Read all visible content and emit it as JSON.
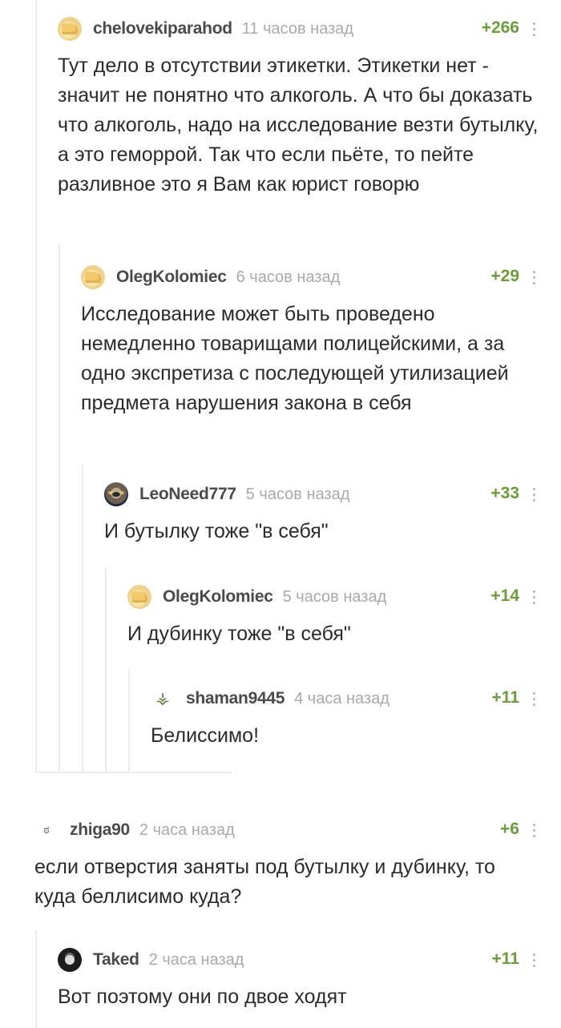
{
  "comments": [
    {
      "user": "chelovekiparahod",
      "time": "11 часов назад",
      "rating": "+266",
      "avatar": "default-avatar",
      "text": "Тут дело в отсутствии этикетки. Этикетки нет - значит не понятно что алкоголь. А что бы доказать что алкоголь, надо на исследование везти бутылку, а это геморрой. Так что если пьёте, то пейте разливное это я Вам как юрист говорю"
    },
    {
      "user": "OlegKolomiec",
      "time": "6 часов назад",
      "rating": "+29",
      "avatar": "default-avatar",
      "text": "Исследование может быть проведено немедленно товарищами полицейскими, а за одно экспретиза с последующей утилизацией предмета нарушения закона в себя"
    },
    {
      "user": "LeoNeed777",
      "time": "5 часов назад",
      "rating": "+33",
      "avatar": "cat-avatar",
      "text": "И бутылку тоже \"в себя\""
    },
    {
      "user": "OlegKolomiec",
      "time": "5 часов назад",
      "rating": "+14",
      "avatar": "default-avatar",
      "text": "И дубинку тоже \"в себя\""
    },
    {
      "user": "shaman9445",
      "time": "4 часа назад",
      "rating": "+11",
      "avatar": "shaman-avatar",
      "text": "Белиссимо!"
    },
    {
      "user": "zhiga90",
      "time": "2 часа назад",
      "rating": "+6",
      "avatar": "zhiga-avatar",
      "text": "если отверстия заняты под бутылку и дубинку, то куда беллисимо куда?"
    },
    {
      "user": "Taked",
      "time": "2 часа назад",
      "rating": "+11",
      "avatar": "taked-avatar",
      "text": "Вот поэтому они по двое ходят"
    }
  ]
}
